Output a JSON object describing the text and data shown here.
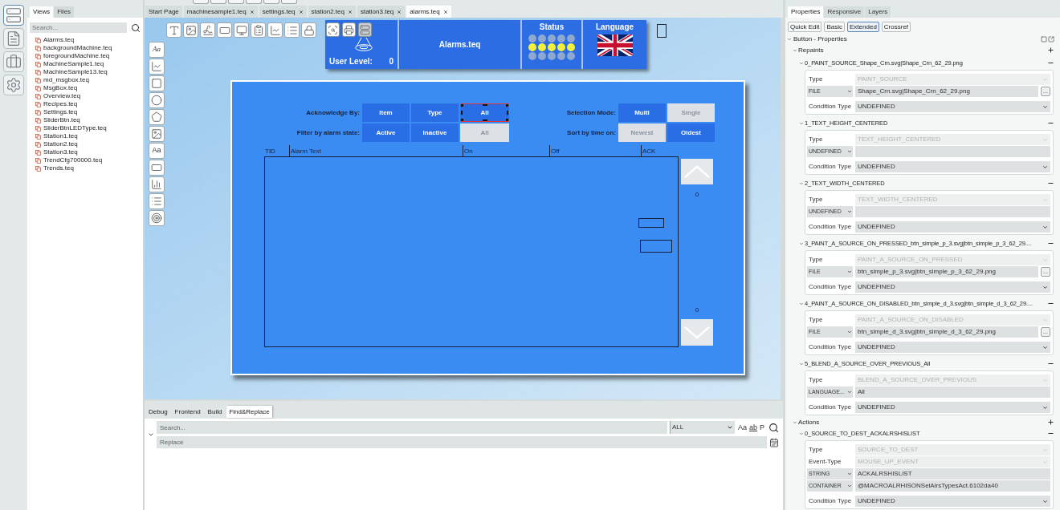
{
  "activity_bar": [
    {
      "selected": true
    },
    {
      "selected": false
    },
    {
      "selected": false
    },
    {
      "selected": false
    }
  ],
  "explorer": {
    "tabs": [
      {
        "label": "Views",
        "selected": true
      },
      {
        "label": "Files",
        "selected": false
      }
    ],
    "search": {
      "placeholder": "Search..."
    },
    "files": [
      "Alarms.teq",
      "backgroundMachine.teq",
      "foregroundMachine.teq",
      "MachineSample1.teq",
      "MachineSample13.teq",
      "md_msgbox.teq",
      "MsgBox.teq",
      "Overview.teq",
      "Recipes.teq",
      "Settings.teq",
      "SliderBtn.teq",
      "SliderBtnLEDType.teq",
      "Station1.teq",
      "Station2.teq",
      "Station3.teq",
      "TrendCfg700000.teq",
      "Trends.teq"
    ]
  },
  "editor": {
    "tabs": [
      {
        "label": "Start Page",
        "closable": false,
        "selected": false
      },
      {
        "label": "machinesample1.teq",
        "closable": true,
        "selected": false
      },
      {
        "label": "settings.teq",
        "closable": true,
        "selected": false
      },
      {
        "label": "station2.teq",
        "closable": true,
        "selected": false
      },
      {
        "label": "station3.teq",
        "closable": true,
        "selected": false
      },
      {
        "label": "alarms.teq",
        "closable": true,
        "selected": true
      }
    ],
    "side_tools": [
      {
        "kind": "text",
        "label": "Aa",
        "italic": true
      },
      {
        "kind": "line"
      },
      {
        "kind": "square"
      },
      {
        "kind": "circle"
      },
      {
        "kind": "pentagon"
      },
      {
        "kind": "image"
      },
      {
        "kind": "text",
        "label": "Aa",
        "italic": false
      },
      {
        "kind": "field"
      },
      {
        "kind": "bars"
      },
      {
        "kind": "list"
      },
      {
        "kind": "dial"
      }
    ],
    "header": {
      "user_label": "User Level:",
      "user_value": "0",
      "title": "Alarms.teq",
      "status": {
        "label": "Status",
        "led_rows": [
          {
            "on": false
          },
          {
            "on": true
          },
          {
            "on": false
          }
        ]
      },
      "language": {
        "label": "Language"
      }
    },
    "dialog": {
      "groups": [
        {
          "rows": [
            {
              "label": "Acknowledge By:",
              "buttons": [
                {
                  "label": "Item",
                  "disabled": false,
                  "selected": false
                },
                {
                  "label": "Type",
                  "disabled": false,
                  "selected": false
                },
                {
                  "label": "All",
                  "disabled": false,
                  "selected": true
                }
              ]
            },
            {
              "label": "Filter by alarm state:",
              "buttons": [
                {
                  "label": "Active",
                  "disabled": false,
                  "selected": false
                },
                {
                  "label": "Inactive",
                  "disabled": false,
                  "selected": false
                },
                {
                  "label": "All",
                  "disabled": true,
                  "selected": false
                }
              ]
            }
          ]
        },
        {
          "rows": [
            {
              "label": "Selection Mode:",
              "buttons": [
                {
                  "label": "Multi",
                  "disabled": false,
                  "selected": false
                },
                {
                  "label": "Single",
                  "disabled": true,
                  "selected": false
                }
              ]
            },
            {
              "label": "Sort by time on:",
              "buttons": [
                {
                  "label": "Newest",
                  "disabled": true,
                  "selected": false
                },
                {
                  "label": "Oldest",
                  "disabled": false,
                  "selected": false
                }
              ]
            }
          ]
        }
      ],
      "columns": [
        "TID",
        "Alarm Text",
        "On",
        "Off",
        "ACK"
      ],
      "scroll_top_count": "0",
      "scroll_bottom_count": "0"
    }
  },
  "bottom_panel": {
    "tabs": [
      {
        "label": "Debug",
        "selected": false
      },
      {
        "label": "Frontend",
        "selected": false
      },
      {
        "label": "Build",
        "selected": false
      },
      {
        "label": "Find&Replace",
        "selected": true
      }
    ],
    "search": {
      "placeholder": "Search..."
    },
    "scope": "ALL",
    "options": [
      {
        "label": "Aa",
        "underline": false
      },
      {
        "label": "ab",
        "underline": true
      },
      {
        "label": "P",
        "underline": false
      }
    ],
    "replace": {
      "placeholder": "Replace"
    }
  },
  "properties": {
    "tabs": [
      {
        "label": "Properties",
        "selected": true
      },
      {
        "label": "Responsive",
        "selected": false
      },
      {
        "label": "Layers",
        "selected": false
      }
    ],
    "modes": [
      {
        "label": "Quick Edit",
        "selected": false
      },
      {
        "label": "Basic",
        "selected": false
      },
      {
        "label": "Extended",
        "selected": true
      },
      {
        "label": "Crossref",
        "selected": false
      }
    ],
    "tree": {
      "title": "Button - Properties",
      "expanded": true,
      "groups": [
        {
          "title": "Repaints",
          "expanded": true,
          "items": [
            {
              "title": "0_PAINT_SOURCE_Shape_Crn.svg|Shape_Crn_62_29.png",
              "expanded": true,
              "rows": [
                {
                  "kind": "fixed",
                  "label": "Type",
                  "value": "PAINT_SOURCE"
                },
                {
                  "kind": "pair",
                  "option": "FILE",
                  "value": "Shape_Crn.svg|Shape_Crn_62_29.png",
                  "button": "..."
                },
                {
                  "kind": "select",
                  "label": "Condition Type",
                  "value": "UNDEFINED"
                }
              ]
            },
            {
              "title": "1_TEXT_HEIGHT_CENTERED",
              "expanded": true,
              "rows": [
                {
                  "kind": "fixed",
                  "label": "Type",
                  "value": "TEXT_HEIGHT_CENTERED"
                },
                {
                  "kind": "pair",
                  "option": "UNDEFINED"
                },
                {
                  "kind": "select",
                  "label": "Condition Type",
                  "value": "UNDEFINED"
                }
              ]
            },
            {
              "title": "2_TEXT_WIDTH_CENTERED",
              "expanded": true,
              "rows": [
                {
                  "kind": "fixed",
                  "label": "Type",
                  "value": "TEXT_WIDTH_CENTERED"
                },
                {
                  "kind": "pair",
                  "option": "UNDEFINED"
                },
                {
                  "kind": "select",
                  "label": "Condition Type",
                  "value": "UNDEFINED"
                }
              ]
            },
            {
              "title": "3_PAINT_A_SOURCE_ON_PRESSED_btn_simple_p_3.svg|btn_simple_p_3_62_29....",
              "expanded": true,
              "rows": [
                {
                  "kind": "fixed",
                  "label": "Type",
                  "value": "PAINT_A_SOURCE_ON_PRESSED"
                },
                {
                  "kind": "pair",
                  "option": "FILE",
                  "value": "btn_simple_p_3.svg|btn_simple_p_3_62_29.png",
                  "button": "..."
                },
                {
                  "kind": "select",
                  "label": "Condition Type",
                  "value": "UNDEFINED"
                }
              ]
            },
            {
              "title": "4_PAINT_A_SOURCE_ON_DISABLED_btn_simple_d_3.svg|btn_simple_d_3_62_29....",
              "expanded": true,
              "rows": [
                {
                  "kind": "fixed",
                  "label": "Type",
                  "value": "PAINT_A_SOURCE_ON_DISABLED"
                },
                {
                  "kind": "pair",
                  "option": "FILE",
                  "value": "btn_simple_d_3.svg|btn_simple_d_3_62_29.png",
                  "button": "..."
                },
                {
                  "kind": "select",
                  "label": "Condition Type",
                  "value": "UNDEFINED"
                }
              ]
            },
            {
              "title": "5_BLEND_A_SOURCE_OVER_PREVIOUS_All",
              "expanded": true,
              "rows": [
                {
                  "kind": "fixed",
                  "label": "Type",
                  "value": "BLEND_A_SOURCE_OVER_PREVIOUS"
                },
                {
                  "kind": "pair",
                  "option": "LANGUAGE...",
                  "value": "All"
                },
                {
                  "kind": "select",
                  "label": "Condition Type",
                  "value": "UNDEFINED"
                }
              ]
            }
          ]
        },
        {
          "title": "Actions",
          "expanded": true,
          "items": [
            {
              "title": "0_SOURCE_TO_DEST_ACKALRSHISLIST",
              "expanded": true,
              "rows": [
                {
                  "kind": "fixed",
                  "label": "Type",
                  "value": "SOURCE_TO_DEST"
                },
                {
                  "kind": "fixed",
                  "label": "Event-Type",
                  "value": "MOUSE_UP_EVENT"
                },
                {
                  "kind": "pair",
                  "option": "STRING",
                  "value": "ACKALRSHISLIST"
                },
                {
                  "kind": "pair",
                  "option": "CONTAINER",
                  "value": "@MACROALRHISONSelAlrsTypesAct.6102da40"
                },
                {
                  "kind": "select",
                  "label": "Condition Type",
                  "value": "UNDEFINED"
                }
              ]
            }
          ]
        }
      ]
    }
  }
}
